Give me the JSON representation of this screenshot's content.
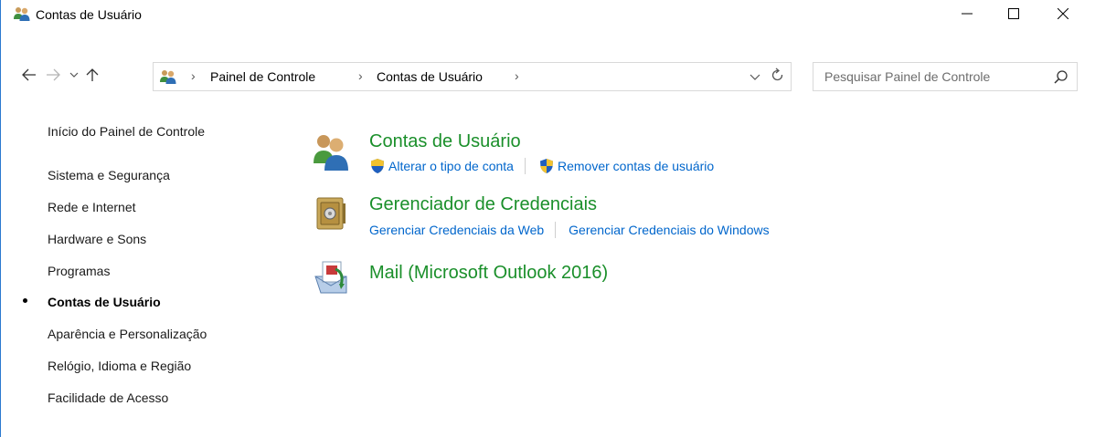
{
  "window": {
    "title": "Contas de Usuário"
  },
  "navigation": {
    "breadcrumbs": [
      {
        "label": "Painel de Controle"
      },
      {
        "label": "Contas de Usuário"
      }
    ],
    "search_placeholder": "Pesquisar Painel de Controle"
  },
  "sidebar": {
    "home": "Início do Painel de Controle",
    "items": [
      {
        "label": "Sistema e Segurança",
        "active": false
      },
      {
        "label": "Rede e Internet",
        "active": false
      },
      {
        "label": "Hardware e Sons",
        "active": false
      },
      {
        "label": "Programas",
        "active": false
      },
      {
        "label": "Contas de Usuário",
        "active": true
      },
      {
        "label": "Aparência e Personalização",
        "active": false
      },
      {
        "label": "Relógio, Idioma e Região",
        "active": false
      },
      {
        "label": "Facilidade de Acesso",
        "active": false
      }
    ]
  },
  "main": {
    "categories": [
      {
        "title": "Contas de Usuário",
        "icon": "users-icon",
        "links": [
          "Alterar o tipo de conta",
          "Remover contas de usuário"
        ]
      },
      {
        "title": "Gerenciador de Credenciais",
        "icon": "credential-vault-icon",
        "links": [
          "Gerenciar Credenciais da Web",
          "Gerenciar Credenciais do Windows"
        ]
      },
      {
        "title": "Mail (Microsoft Outlook 2016)",
        "icon": "mail-icon",
        "links": []
      }
    ]
  },
  "colors": {
    "category_title": "#1a8f2a",
    "link": "#0066cc",
    "window_border": "#2b79d0"
  }
}
